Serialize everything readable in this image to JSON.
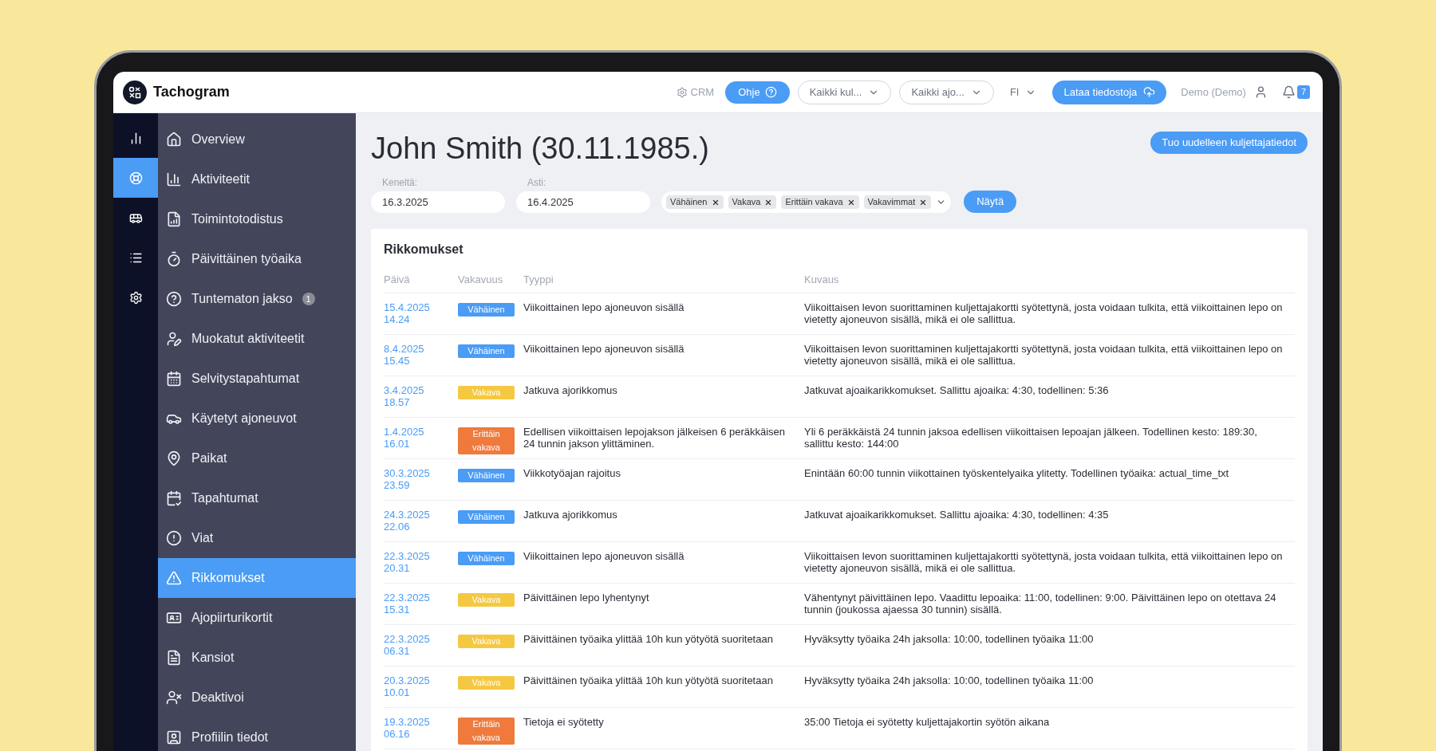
{
  "app": {
    "name": "Tachogram"
  },
  "header": {
    "crm": "CRM",
    "help": "Ohje",
    "dropdowns": [
      "Kaikki kul...",
      "Kaikki ajo...",
      "FI"
    ],
    "upload": "Lataa tiedostoja",
    "user": "Demo (Demo)",
    "notifications": "7"
  },
  "rail": [
    {
      "selected": false
    },
    {
      "selected": true
    },
    {
      "selected": false
    },
    {
      "selected": false
    },
    {
      "selected": false
    }
  ],
  "nav": [
    {
      "label": "Overview",
      "selected": false
    },
    {
      "label": "Aktiviteetit",
      "selected": false
    },
    {
      "label": "Toimintotodistus",
      "selected": false
    },
    {
      "label": "Päivittäinen työaika",
      "selected": false
    },
    {
      "label": "Tuntematon jakso",
      "badge": "1",
      "selected": false
    },
    {
      "label": "Muokatut aktiviteetit",
      "selected": false
    },
    {
      "label": "Selvitystapahtumat",
      "selected": false
    },
    {
      "label": "Käytetyt ajoneuvot",
      "selected": false
    },
    {
      "label": "Paikat",
      "selected": false
    },
    {
      "label": "Tapahtumat",
      "selected": false
    },
    {
      "label": "Viat",
      "selected": false
    },
    {
      "label": "Rikkomukset",
      "selected": true
    },
    {
      "label": "Ajopiirturikortit",
      "selected": false
    },
    {
      "label": "Kansiot",
      "selected": false
    },
    {
      "label": "Deaktivoi",
      "selected": false
    },
    {
      "label": "Profiilin tiedot",
      "selected": false
    }
  ],
  "page": {
    "title": "John Smith (30.11.1985.)",
    "reimport": "Tuo uudelleen kuljettajatiedot"
  },
  "filters": {
    "from_label": "Keneltä:",
    "from": "16.3.2025",
    "to_label": "Asti:",
    "to": "16.4.2025",
    "chips": [
      "Vähäinen",
      "Vakava",
      "Erittäin vakava",
      "Vakavimmat"
    ],
    "submit": "Näytä"
  },
  "violations": {
    "title": "Rikkomukset",
    "columns": [
      "Päivä",
      "Vakavuus",
      "Tyyppi",
      "Kuvaus"
    ],
    "rows": [
      {
        "date": "15.4.2025",
        "time": "14.24",
        "severity": "Vähäinen",
        "kind": "minor",
        "type": "Viikoittainen lepo ajoneuvon sisällä",
        "description": "Viikoittaisen levon suorittaminen kuljettajakortti syötettynä, josta voidaan tulkita, että viikoittainen lepo on vietetty ajoneuvon sisällä, mikä ei ole sallittua."
      },
      {
        "date": "8.4.2025",
        "time": "15.45",
        "severity": "Vähäinen",
        "kind": "minor",
        "type": "Viikoittainen lepo ajoneuvon sisällä",
        "description": "Viikoittaisen levon suorittaminen kuljettajakortti syötettynä, josta voidaan tulkita, että viikoittainen lepo on vietetty ajoneuvon sisällä, mikä ei ole sallittua."
      },
      {
        "date": "3.4.2025",
        "time": "18.57",
        "severity": "Vakava",
        "kind": "serious",
        "type": "Jatkuva ajorikkomus",
        "description": "Jatkuvat ajoaikarikkomukset. Sallittu ajoaika: 4:30, todellinen: 5:36"
      },
      {
        "date": "1.4.2025",
        "time": "16.01",
        "severity": "Erittäin vakava",
        "kind": "very_serious",
        "type": "Edellisen viikoittaisen lepojakson jälkeisen 6 peräkkäisen 24 tunnin jakson ylittäminen.",
        "description": "Yli 6 peräkkäistä 24 tunnin jaksoa edellisen viikoittaisen lepoajan jälkeen. Todellinen kesto: 189:30, sallittu kesto: 144:00"
      },
      {
        "date": "30.3.2025",
        "time": "23.59",
        "severity": "Vähäinen",
        "kind": "minor",
        "type": "Viikkotyöajan rajoitus",
        "description": "Enintään 60:00 tunnin viikottainen työskentelyaika ylitetty. Todellinen työaika: actual_time_txt"
      },
      {
        "date": "24.3.2025",
        "time": "22.06",
        "severity": "Vähäinen",
        "kind": "minor",
        "type": "Jatkuva ajorikkomus",
        "description": "Jatkuvat ajoaikarikkomukset. Sallittu ajoaika: 4:30, todellinen: 4:35"
      },
      {
        "date": "22.3.2025",
        "time": "20.31",
        "severity": "Vähäinen",
        "kind": "minor",
        "type": "Viikoittainen lepo ajoneuvon sisällä",
        "description": "Viikoittaisen levon suorittaminen kuljettajakortti syötettynä, josta voidaan tulkita, että viikoittainen lepo on vietetty ajoneuvon sisällä, mikä ei ole sallittua."
      },
      {
        "date": "22.3.2025",
        "time": "15.31",
        "severity": "Vakava",
        "kind": "serious",
        "type": "Päivittäinen lepo lyhentynyt",
        "description": "Vähentynyt päivittäinen lepo. Vaadittu lepoaika: 11:00, todellinen: 9:00. Päivittäinen lepo on otettava 24 tunnin (joukossa ajaessa 30 tunnin) sisällä."
      },
      {
        "date": "22.3.2025",
        "time": "06.31",
        "severity": "Vakava",
        "kind": "serious",
        "type": "Päivittäinen työaika ylittää 10h kun yötyötä suoritetaan",
        "description": "Hyväksytty työaika 24h jaksolla: 10:00, todellinen työaika 11:00"
      },
      {
        "date": "20.3.2025",
        "time": "10.01",
        "severity": "Vakava",
        "kind": "serious",
        "type": "Päivittäinen työaika ylittää 10h kun yötyötä suoritetaan",
        "description": "Hyväksytty työaika 24h jaksolla: 10:00, todellinen työaika 11:00"
      },
      {
        "date": "19.3.2025",
        "time": "06.16",
        "severity": "Erittäin vakava",
        "kind": "very_serious",
        "type": "Tietoja ei syötetty",
        "description": "35:00 Tietoja ei syötetty kuljettajakortin syötön aikana"
      }
    ]
  }
}
